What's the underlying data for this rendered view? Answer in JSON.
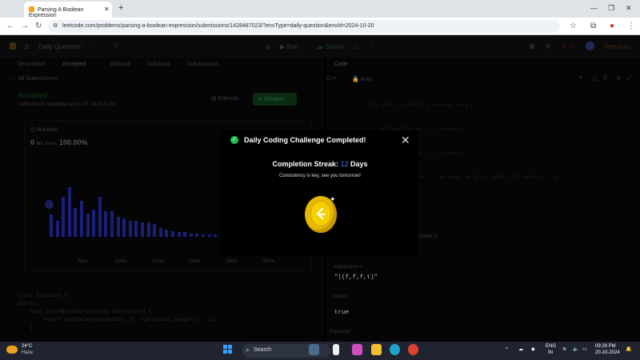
{
  "browser": {
    "tab_title": "Parsing A Boolean Expression",
    "url": "leetcode.com/problems/parsing-a-boolean-expression/submissions/1428487023/?envType=daily-question&envId=2024-10-20"
  },
  "header": {
    "daily_question": "Daily Question",
    "run": "Run",
    "submit": "Submit",
    "streak_count": "12",
    "premium": "Premium"
  },
  "left": {
    "tabs": [
      "Description",
      "Accepted",
      "Editorial",
      "Solutions",
      "Submissions"
    ],
    "all_submissions": "All Submissions",
    "accepted": "Accepted",
    "user_line": "wZ9u7mlAC submitted at Oct 20, 2024 21:28",
    "editorial_btn": "Editorial",
    "solution_btn": "Solution",
    "runtime_label": "Runtime",
    "runtime_value": "0",
    "runtime_unit": "ms",
    "beats_label": "Beats",
    "beats_value": "100.00%",
    "x_ticks": [
      "5ms",
      "11ms",
      "17ms",
      "23ms",
      "29ms",
      "35ms"
    ],
    "code_lines": [
      "class Solution {",
      "public:",
      "    bool parseBoolExpr(string expression) {",
      "        return evaluate(expression, 0, expression.length() - 1);",
      "    }"
    ]
  },
  "right": {
    "code_tab": "Code",
    "lang": "C++",
    "auto": "Auto",
    "code_lines": [
      "for (int i = start; i <= end; ++i) {",
      "    if (expr[i] == '(') ++count;",
      "    if (expr[i] == ')') --count;",
      "    if ((expr[i] == ',' && count == 0) || count < 0) return i - 1;",
      "}"
    ],
    "case_label": "Case 3",
    "expression_label": "expression =",
    "expression_value": "\"|(f,f,f,t)\"",
    "output_label": "Output",
    "output_value": "true",
    "expected_label": "Expected"
  },
  "modal": {
    "title": "Daily Coding Challenge Completed!",
    "streak_label": "Completion Streak:",
    "streak_value": "12",
    "streak_unit": "Days",
    "subtitle": "Consistency is key, see you tomorrow!",
    "check_icon": "✓"
  },
  "chart_data": {
    "type": "bar",
    "title": "",
    "xlabel": "",
    "ylabel": "",
    "x_ticks": [
      "5ms",
      "11ms",
      "17ms",
      "23ms",
      "29ms",
      "35ms"
    ],
    "values": [
      25,
      18,
      44,
      55,
      32,
      40,
      26,
      30,
      44,
      28,
      28,
      22,
      20,
      18,
      18,
      16,
      16,
      14,
      10,
      8,
      6,
      5,
      5,
      4,
      4,
      3,
      3,
      3
    ]
  },
  "taskbar": {
    "weather_temp": "24°C",
    "weather_desc": "Haze",
    "search": "Search",
    "lang": "ENG",
    "region": "IN",
    "time": "09:29 PM",
    "date": "20-10-2024"
  }
}
